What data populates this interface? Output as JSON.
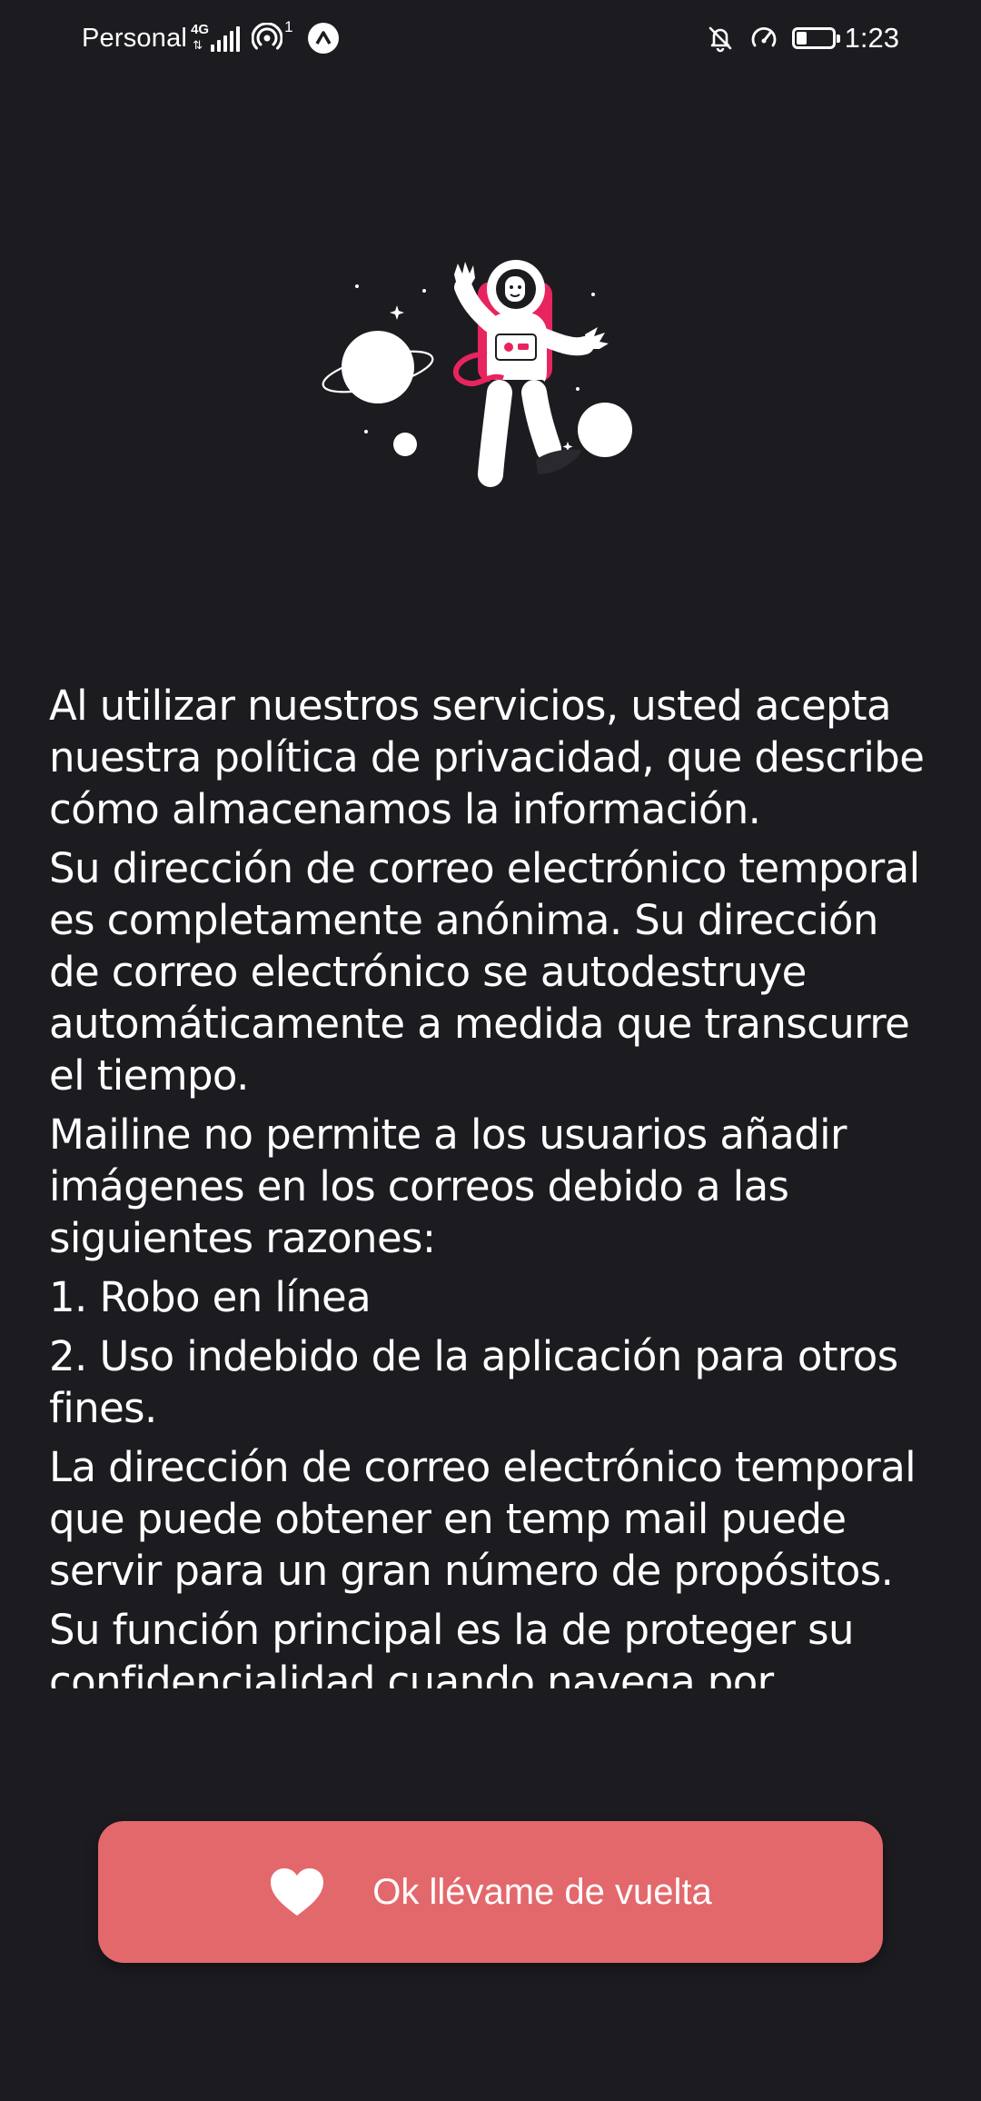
{
  "status_bar": {
    "carrier": "Personal",
    "network_type": "4G",
    "hotspot_count": "1",
    "time": "1:23",
    "battery_level_percent": 30,
    "icons_left": [
      "lte-icon",
      "signal-icon",
      "hotspot-icon",
      "app-notification-icon"
    ],
    "icons_right": [
      "bell-off-icon",
      "speedometer-icon",
      "battery-icon"
    ]
  },
  "illustration": {
    "name": "astronaut-floating-in-space",
    "accent_color": "#e8245f"
  },
  "content": {
    "paragraphs": [
      "Al utilizar nuestros servicios, usted acepta nuestra política de privacidad, que describe cómo almacenamos la información.",
      "Su dirección de correo electrónico temporal es completamente anónima. Su dirección de correo electrónico se autodestruye automáticamente a medida que transcurre el tiempo.",
      "Mailine no permite a los usuarios añadir imágenes en los correos debido a las siguientes razones:",
      "1. Robo en línea",
      "2. Uso indebido de la aplicación para otros fines.",
      "La dirección de correo electrónico temporal que puede obtener en temp mail puede servir para un gran número de propósitos.",
      "Su función principal es la de proteger su confidencialidad cuando navega por Internet"
    ]
  },
  "button": {
    "label": "Ok llévame de vuelta",
    "icon": "heart-icon",
    "color": "#e3686b"
  },
  "theme": {
    "background": "#1c1b20",
    "text": "#ffffff"
  }
}
